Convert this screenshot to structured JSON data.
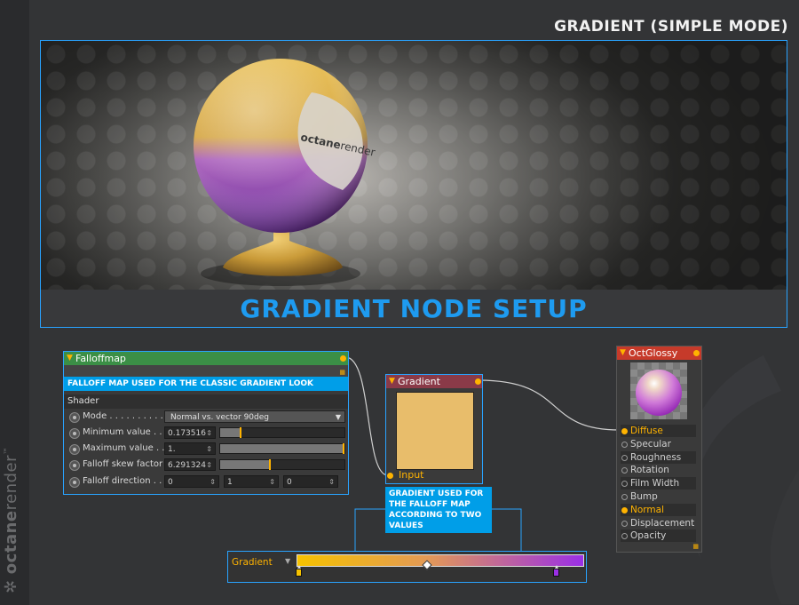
{
  "page_title": "GRADIENT (SIMPLE MODE)",
  "brand": {
    "prefix": "octane",
    "suffix": "render",
    "mark": "™"
  },
  "banner": "GRADIENT NODE SETUP",
  "preview": {
    "sphere_text_a": "octane",
    "sphere_text_b": "render"
  },
  "falloff_node": {
    "title": "Falloffmap",
    "callout": "FALLOFF MAP USED FOR THE CLASSIC GRADIENT LOOK",
    "section": "Shader",
    "rows": [
      {
        "label": "Mode . . . . . . . . . . .",
        "value": "Normal vs. vector 90deg"
      },
      {
        "label": "Minimum value . . .",
        "value": "0.173516",
        "fraction": 0.17
      },
      {
        "label": "Maximum value . . .",
        "value": "1.",
        "fraction": 1.0
      },
      {
        "label": "Falloff skew factor",
        "value": "6.291324",
        "fraction": 0.41
      },
      {
        "label": "Falloff direction  . .",
        "values": [
          "0",
          "1",
          "0"
        ]
      }
    ]
  },
  "gradient_node": {
    "title": "Gradient",
    "input_label": "Input",
    "swatch_color": "#e8bd6b",
    "callout": "GRADIENT USED FOR THE FALLOFF MAP ACCORDING TO TWO VALUES"
  },
  "glossy_node": {
    "title": "OctGlossy",
    "inputs": [
      "Diffuse",
      "Specular",
      "Roughness",
      "Rotation",
      "Film Width",
      "Bump",
      "Normal",
      "Displacement",
      "Opacity"
    ],
    "active_inputs": [
      "Diffuse",
      "Normal"
    ]
  },
  "gradient_bar": {
    "label": "Gradient",
    "start_color": "#f6c200",
    "end_color": "#9a2fe6",
    "midpoint_fraction": 0.45
  },
  "colors": {
    "accent": "#29a3ff",
    "callout": "#009ee8",
    "port": "#ffb300"
  }
}
